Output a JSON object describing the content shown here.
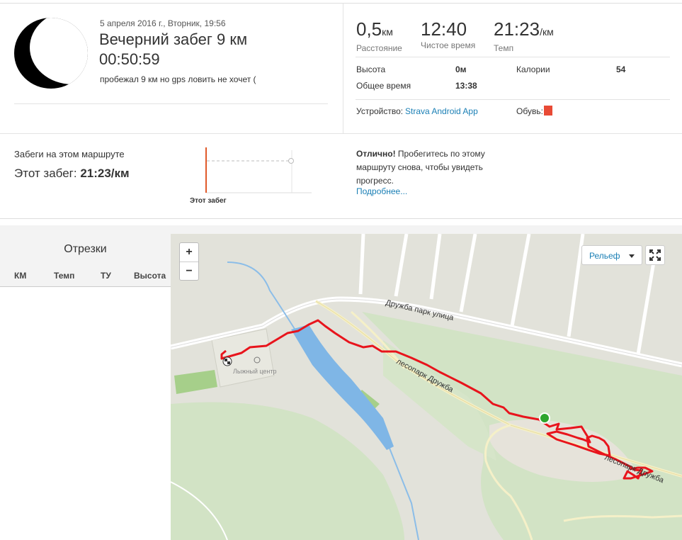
{
  "activity": {
    "date": "5 апреля 2016 г., Вторник, 19:56",
    "title": "Вечерний забег 9 км",
    "duration": "00:50:59",
    "description": "пробежал 9 км но gps ловить не хочет ("
  },
  "stats": {
    "distance": {
      "value": "0,5",
      "unit": "км",
      "label": "Расстояние"
    },
    "moving_time": {
      "value": "12:40",
      "label": "Чистое время"
    },
    "pace": {
      "value": "21:23",
      "unit": "/км",
      "label": "Темп"
    },
    "elevation": {
      "label": "Высота",
      "value": "0м"
    },
    "calories": {
      "label": "Калории",
      "value": "54"
    },
    "elapsed": {
      "label": "Общее время",
      "value": "13:38"
    },
    "device": {
      "label": "Устройство:",
      "value": "Strava Android App"
    },
    "shoes": {
      "label": "Обувь:"
    }
  },
  "comparison": {
    "label": "Забеги на этом маршруте",
    "this_run_prefix": "Этот забег:",
    "this_run_value": "21:23/км",
    "chart_axis_label": "Этот забег",
    "note_bold": "Отлично!",
    "note_text": " Пробегитесь по этому маршруту снова, чтобы увидеть прогресс.",
    "more_link": "Подробнее..."
  },
  "splits": {
    "title": "Отрезки",
    "columns": [
      "КМ",
      "Темп",
      "ТУ",
      "Высота"
    ]
  },
  "map": {
    "zoom_in": "+",
    "zoom_out": "−",
    "layer_select": "Рельеф",
    "labels": {
      "street": "Дружба парк улица",
      "forest1": "лесопарк Дружба",
      "forest2": "лесопарк Дружба",
      "ski": "Лыжный центр"
    },
    "colors": {
      "route": "#e8141c",
      "start": "#2ea62e",
      "water": "#7fb6e6",
      "park": "#cfe2c0"
    }
  }
}
